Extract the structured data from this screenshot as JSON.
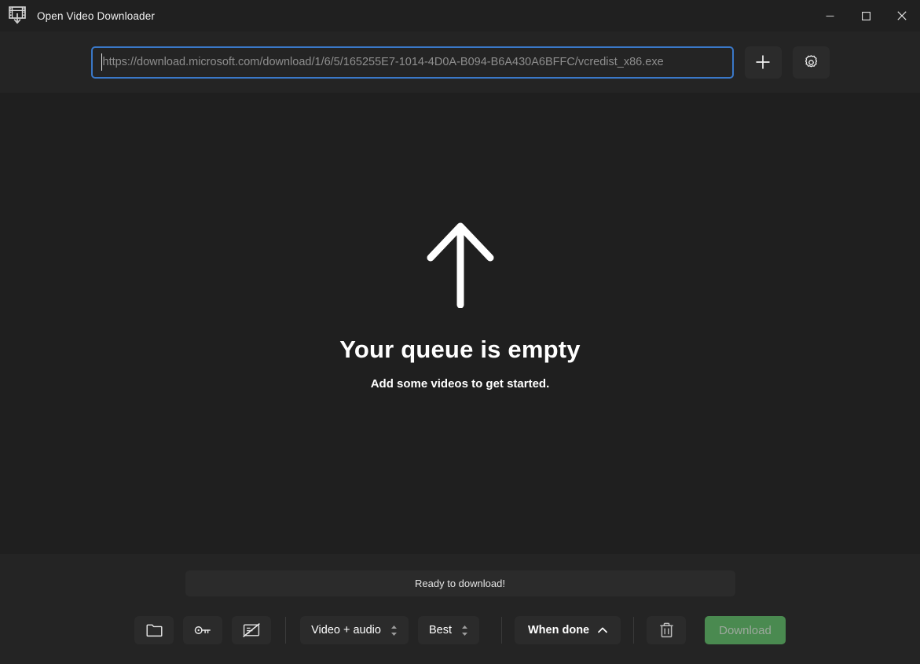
{
  "window": {
    "title": "Open Video Downloader",
    "app_icon": "film-download-icon",
    "controls": {
      "minimize": "minimize-icon",
      "maximize": "maximize-icon",
      "close": "close-icon"
    }
  },
  "header": {
    "url_input": {
      "value": "",
      "placeholder": "https://download.microsoft.com/download/1/6/5/165255E7-1014-4D0A-B094-B6A430A6BFFC/vcredist_x86.exe",
      "focused": true,
      "border_color": "#3a78c8"
    },
    "add_button": {
      "label": "",
      "icon": "plus-icon"
    },
    "settings_button": {
      "label": "",
      "icon": "gear-icon"
    }
  },
  "main": {
    "illustration": "up-arrow-icon",
    "title": "Your queue is empty",
    "subtitle": "Add some videos to get started."
  },
  "footer": {
    "status": "Ready to download!",
    "toolbar": {
      "folder_button": {
        "icon": "folder-icon"
      },
      "key_button": {
        "icon": "key-icon"
      },
      "no_subtitles_button": {
        "icon": "screen-slash-icon"
      },
      "format_select": {
        "value": "Video + audio",
        "icon": "spinner-arrows-icon"
      },
      "quality_select": {
        "value": "Best",
        "icon": "spinner-arrows-icon"
      },
      "when_done_menu": {
        "value": "When done",
        "icon": "caret-up-icon"
      },
      "clear_button": {
        "icon": "trash-icon"
      },
      "download_button": {
        "label": "Download"
      }
    }
  },
  "colors": {
    "window_bg": "#1f1f1f",
    "panel_bg": "#242424",
    "control_bg": "#2b2b2b",
    "accent_green": "#4a8a50",
    "focus_blue": "#3a78c8",
    "text_primary": "#ffffff",
    "text_muted": "#8e8e8e"
  }
}
